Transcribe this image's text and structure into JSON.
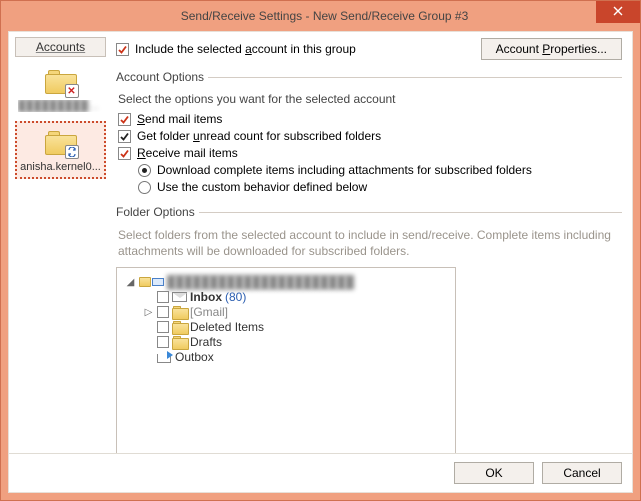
{
  "window": {
    "title": "Send/Receive Settings - New Send/Receive Group #3"
  },
  "left": {
    "header": "Accounts",
    "accounts": [
      {
        "label": "████████████",
        "selected": false,
        "disabled": true
      },
      {
        "label": "anisha.kernel0...",
        "selected": true,
        "disabled": false
      }
    ]
  },
  "top": {
    "include_label_pre": "Include the selected ",
    "include_label_u": "a",
    "include_label_post": "ccount in this group",
    "include_checked": true,
    "account_properties_pre": "Account ",
    "account_properties_u": "P",
    "account_properties_post": "roperties..."
  },
  "account_options": {
    "legend": "Account Options",
    "desc": "Select the options you want for the selected account",
    "send": {
      "u": "S",
      "post": "end mail items",
      "checked": true,
      "red": true
    },
    "unread": {
      "pre": "Get folder ",
      "u": "u",
      "post": "nread count for subscribed folders",
      "checked": true,
      "red": false
    },
    "receive": {
      "u": "R",
      "post": "eceive mail items",
      "checked": true,
      "red": true
    },
    "radio": {
      "download": "Download complete items including attachments for subscribed folders",
      "custom": "Use the custom behavior defined below",
      "selected": "download"
    }
  },
  "folder_options": {
    "legend": "Folder Options",
    "desc": "Select folders from the selected account to include in send/receive. Complete items including attachments will be downloaded for subscribed folders.",
    "tree": {
      "root": "██████████████████████",
      "items": [
        {
          "name": "Inbox",
          "count": "(80)",
          "icon": "envelope",
          "checkbox": true,
          "bold": true
        },
        {
          "name": "[Gmail]",
          "icon": "folder",
          "checkbox": true,
          "expander": true,
          "grey": true
        },
        {
          "name": "Deleted Items",
          "icon": "folder",
          "checkbox": true,
          "indent": true
        },
        {
          "name": "Drafts",
          "icon": "folder",
          "checkbox": true,
          "indent": true
        },
        {
          "name": "Outbox",
          "icon": "outbox",
          "checkbox": false,
          "indent": true
        }
      ]
    }
  },
  "footer": {
    "ok": "OK",
    "cancel": "Cancel"
  }
}
